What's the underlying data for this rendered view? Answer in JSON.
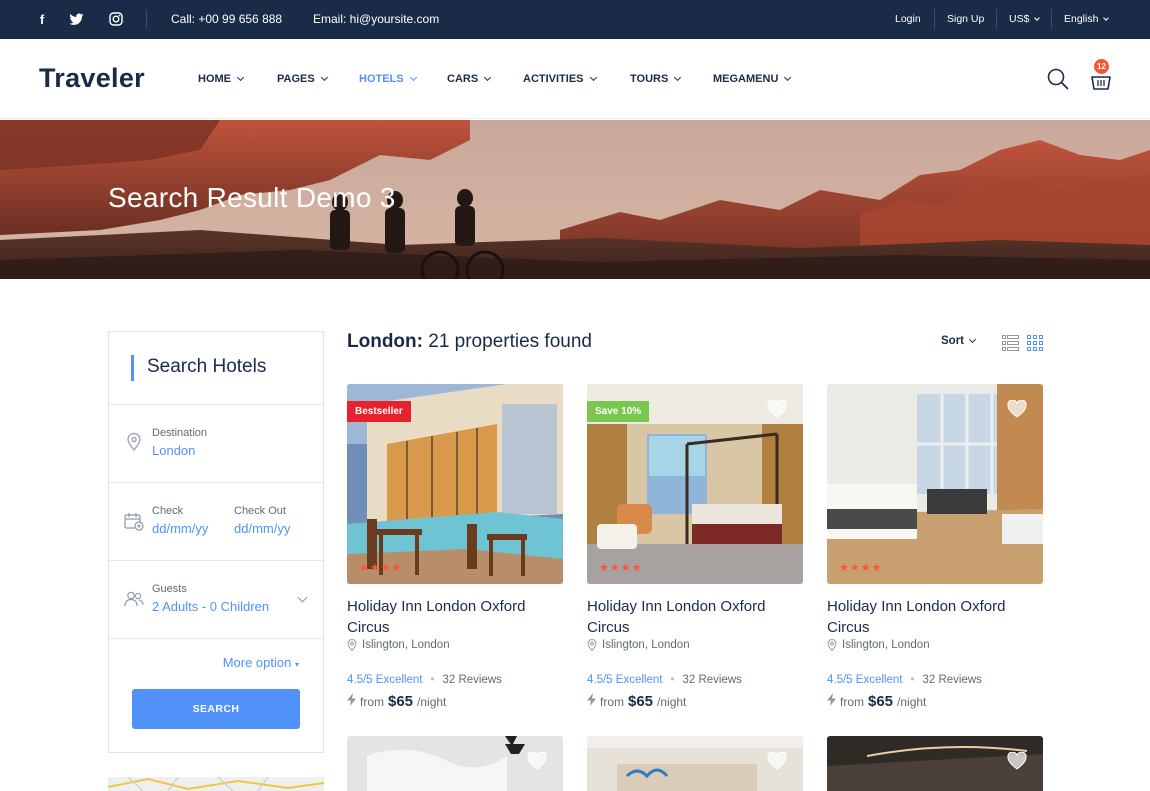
{
  "topbar": {
    "social_icons": [
      "facebook-icon",
      "twitter-icon",
      "instagram-icon"
    ],
    "call": "Call: +00 99 656 888",
    "email": "Email: hi@yoursite.com",
    "login": "Login",
    "signup": "Sign Up",
    "currency": "US$",
    "language": "English"
  },
  "header": {
    "logo": "Traveler",
    "nav": [
      "HOME",
      "PAGES",
      "HOTELS",
      "CARS",
      "ACTIVITIES",
      "TOURS",
      "MEGAMENU"
    ],
    "active_nav": "HOTELS",
    "cart_count": "12"
  },
  "hero": {
    "title": "Search Result Demo 3"
  },
  "sidebar": {
    "title": "Search Hotels",
    "destination_label": "Destination",
    "destination_value": "London",
    "checkin_label": "Check",
    "checkin_value": "dd/mm/yy",
    "checkout_label": "Check Out",
    "checkout_value": "dd/mm/yy",
    "guests_label": "Guests",
    "guests_value": "2 Adults - 0 Children",
    "more_option": "More option",
    "search_button": "SEARCH"
  },
  "results": {
    "city": "London:",
    "count_text": "21 properties found",
    "sort_label": "Sort",
    "cards": [
      {
        "badge": "Bestseller",
        "badge_color": "#e8212e",
        "name": "Holiday Inn London Oxford Circus",
        "location": "Islington, London",
        "rating": "4.5/5 Excellent",
        "reviews": "32 Reviews",
        "from": "from",
        "price": "$65",
        "per": "/night",
        "stars": "★★★★"
      },
      {
        "badge": "Save 10%",
        "badge_color": "#7ac74f",
        "name": "Holiday Inn London Oxford Circus",
        "location": "Islington, London",
        "rating": "4.5/5 Excellent",
        "reviews": "32 Reviews",
        "from": "from",
        "price": "$65",
        "per": "/night",
        "stars": "★★★★"
      },
      {
        "badge": "",
        "badge_color": "",
        "name": "Holiday Inn London Oxford Circus",
        "location": "Islington, London",
        "rating": "4.5/5 Excellent",
        "reviews": "32 Reviews",
        "from": "from",
        "price": "$65",
        "per": "/night",
        "stars": "★★★★"
      }
    ]
  },
  "colors": {
    "primary": "#5191fa",
    "navy": "#1a2b48",
    "star": "#fa5636"
  }
}
